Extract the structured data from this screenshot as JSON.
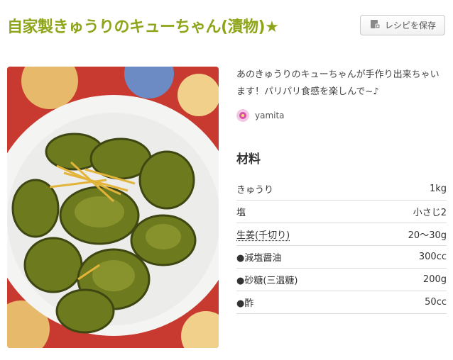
{
  "recipe": {
    "title": "自家製きゅうりのキューちゃん(漬物)★",
    "description": "あのきゅうりのキューちゃんが手作り出来ちゃいます！パリパリ食感を楽しんで~♪",
    "author": "yamita",
    "save_label": "レシピを保存"
  },
  "ingredients_section": {
    "title": "材料",
    "items": [
      {
        "name": "きゅうり",
        "amount": "1kg"
      },
      {
        "name": "塩",
        "amount": "小さじ2"
      },
      {
        "name": "生姜(千切り)",
        "amount": "20～30g"
      },
      {
        "name": "●減塩醤油",
        "amount": "300cc"
      },
      {
        "name": "●砂糖(三温糖)",
        "amount": "200g"
      },
      {
        "name": "●酢",
        "amount": "50cc"
      }
    ]
  },
  "colors": {
    "title": "#8ea51a",
    "text": "#333333",
    "divider": "#dcdcdc"
  },
  "icons": {
    "save": "bookmark-save-icon",
    "avatar": "flower-avatar"
  }
}
